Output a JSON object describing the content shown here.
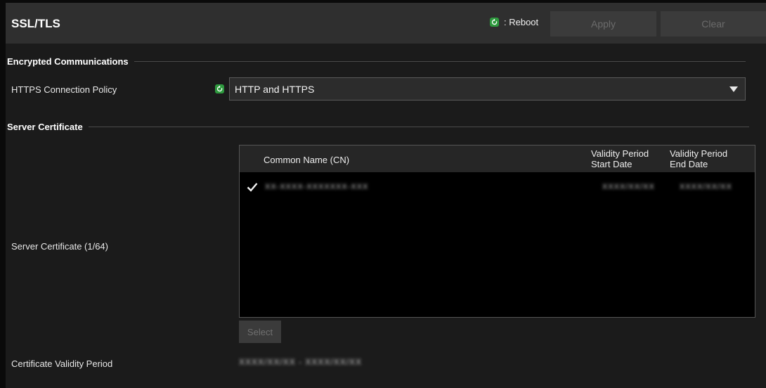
{
  "header": {
    "title": "SSL/TLS",
    "reboot_legend": ": Reboot",
    "apply_label": "Apply",
    "clear_label": "Clear"
  },
  "encrypted_section": {
    "heading": "Encrypted Communications",
    "policy_label": "HTTPS Connection Policy",
    "policy_value": "HTTP and HTTPS"
  },
  "server_section": {
    "heading": "Server Certificate",
    "certificate_label": "Server Certificate (1/64)",
    "table": {
      "columns": {
        "cn": "Common Name (CN)",
        "start_line1": "Validity Period",
        "start_line2": "Start Date",
        "end_line1": "Validity Period",
        "end_line2": "End Date"
      },
      "rows": [
        {
          "selected": true,
          "cn": "XX-XXXX-XXXXXXX-XXX",
          "start": "XXXX/XX/XX",
          "end": "XXXX/XX/XX"
        }
      ]
    },
    "select_label": "Select",
    "validity_label": "Certificate Validity Period",
    "validity_value": "XXXX/XX/XX - XXXX/XX/XX"
  },
  "icons": {
    "reboot": "reboot-icon",
    "check": "check-icon",
    "dropdown": "chevron-down-icon"
  },
  "colors": {
    "reboot_green": "#2e9a3e",
    "background": "#1b1b1b",
    "header_bg": "#2f2f2f",
    "disabled_button": "#3b3b3b"
  }
}
